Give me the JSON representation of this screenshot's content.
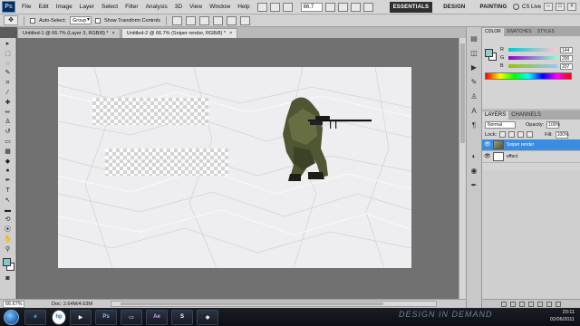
{
  "menubar": {
    "logo": "Ps",
    "items": [
      "File",
      "Edit",
      "Image",
      "Layer",
      "Select",
      "Filter",
      "Analysis",
      "3D",
      "View",
      "Window",
      "Help"
    ],
    "zoom": "66.7",
    "workspaces": [
      "ESSENTIALS",
      "DESIGN",
      "PAINTING"
    ],
    "cs_live": "CS Live"
  },
  "optionsbar": {
    "auto_select_label": "Auto-Select:",
    "auto_select_value": "Group",
    "show_transform_label": "Show Transform Controls"
  },
  "doc_tabs": [
    "Untitled-1 @ 66.7% (Layer 3, RGB/8) *",
    "Untitled-2 @ 66.7% (Sniper render, RGB/8) *"
  ],
  "status": {
    "zoom": "66.67%",
    "doc": "Doc: 2.64M/4.63M"
  },
  "color_panel": {
    "tabs": [
      "COLOR",
      "SWATCHES",
      "STYLES"
    ],
    "channels": [
      {
        "label": "R",
        "value": "144"
      },
      {
        "label": "G",
        "value": "200"
      },
      {
        "label": "B",
        "value": "207"
      }
    ],
    "foreground": "#90cfcf"
  },
  "layers_panel": {
    "tabs": [
      "LAYERS",
      "CHANNELS"
    ],
    "blend_mode": "Normal",
    "opacity_label": "Opacity:",
    "opacity": "100%",
    "lock_label": "Lock:",
    "fill_label": "Fill:",
    "fill": "100%",
    "layers": [
      {
        "name": "Sniper render",
        "selected": true
      },
      {
        "name": "effect",
        "selected": false
      }
    ]
  },
  "taskbar": {
    "apps": [
      "hp",
      "Ps",
      "Ae"
    ],
    "brand": "DESIGN IN DEMAND",
    "time": "20:11",
    "date": "02/06/2011"
  }
}
